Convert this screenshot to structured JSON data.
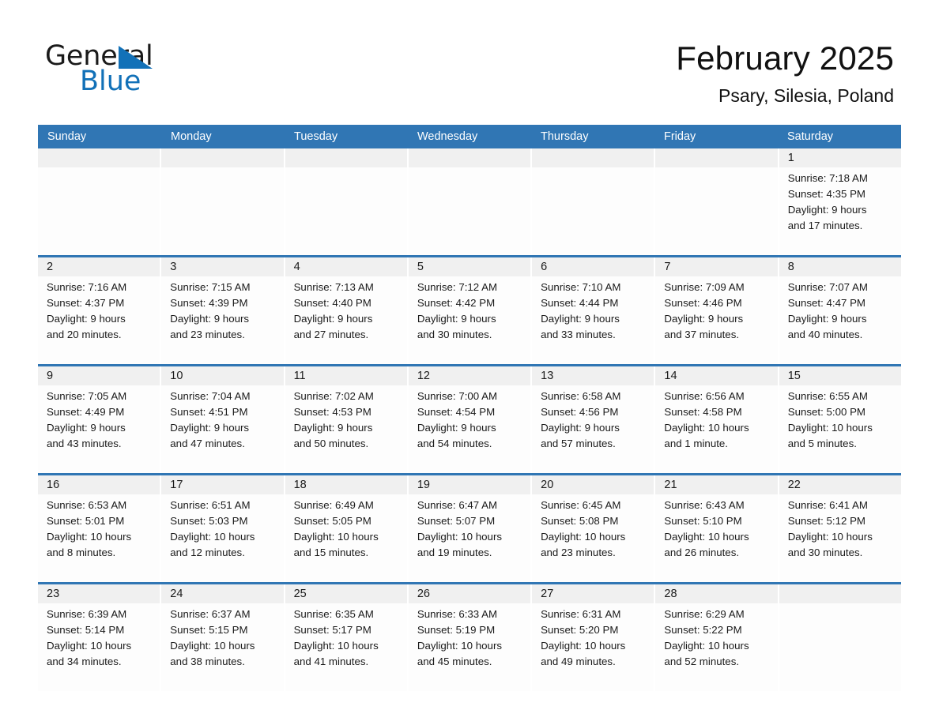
{
  "brand": {
    "name_part1": "General",
    "name_part2": "Blue",
    "triangle_color": "#1271b8"
  },
  "header": {
    "title": "February 2025",
    "subtitle": "Psary, Silesia, Poland"
  },
  "theme": {
    "header_blue": "#3076b4",
    "day_band_gray": "#f0f0f0",
    "text_color": "#1a1a1a"
  },
  "weekdays": [
    "Sunday",
    "Monday",
    "Tuesday",
    "Wednesday",
    "Thursday",
    "Friday",
    "Saturday"
  ],
  "weeks": [
    [
      {
        "num": "",
        "lines": []
      },
      {
        "num": "",
        "lines": []
      },
      {
        "num": "",
        "lines": []
      },
      {
        "num": "",
        "lines": []
      },
      {
        "num": "",
        "lines": []
      },
      {
        "num": "",
        "lines": []
      },
      {
        "num": "1",
        "lines": [
          "Sunrise: 7:18 AM",
          "Sunset: 4:35 PM",
          "Daylight: 9 hours",
          "and 17 minutes."
        ]
      }
    ],
    [
      {
        "num": "2",
        "lines": [
          "Sunrise: 7:16 AM",
          "Sunset: 4:37 PM",
          "Daylight: 9 hours",
          "and 20 minutes."
        ]
      },
      {
        "num": "3",
        "lines": [
          "Sunrise: 7:15 AM",
          "Sunset: 4:39 PM",
          "Daylight: 9 hours",
          "and 23 minutes."
        ]
      },
      {
        "num": "4",
        "lines": [
          "Sunrise: 7:13 AM",
          "Sunset: 4:40 PM",
          "Daylight: 9 hours",
          "and 27 minutes."
        ]
      },
      {
        "num": "5",
        "lines": [
          "Sunrise: 7:12 AM",
          "Sunset: 4:42 PM",
          "Daylight: 9 hours",
          "and 30 minutes."
        ]
      },
      {
        "num": "6",
        "lines": [
          "Sunrise: 7:10 AM",
          "Sunset: 4:44 PM",
          "Daylight: 9 hours",
          "and 33 minutes."
        ]
      },
      {
        "num": "7",
        "lines": [
          "Sunrise: 7:09 AM",
          "Sunset: 4:46 PM",
          "Daylight: 9 hours",
          "and 37 minutes."
        ]
      },
      {
        "num": "8",
        "lines": [
          "Sunrise: 7:07 AM",
          "Sunset: 4:47 PM",
          "Daylight: 9 hours",
          "and 40 minutes."
        ]
      }
    ],
    [
      {
        "num": "9",
        "lines": [
          "Sunrise: 7:05 AM",
          "Sunset: 4:49 PM",
          "Daylight: 9 hours",
          "and 43 minutes."
        ]
      },
      {
        "num": "10",
        "lines": [
          "Sunrise: 7:04 AM",
          "Sunset: 4:51 PM",
          "Daylight: 9 hours",
          "and 47 minutes."
        ]
      },
      {
        "num": "11",
        "lines": [
          "Sunrise: 7:02 AM",
          "Sunset: 4:53 PM",
          "Daylight: 9 hours",
          "and 50 minutes."
        ]
      },
      {
        "num": "12",
        "lines": [
          "Sunrise: 7:00 AM",
          "Sunset: 4:54 PM",
          "Daylight: 9 hours",
          "and 54 minutes."
        ]
      },
      {
        "num": "13",
        "lines": [
          "Sunrise: 6:58 AM",
          "Sunset: 4:56 PM",
          "Daylight: 9 hours",
          "and 57 minutes."
        ]
      },
      {
        "num": "14",
        "lines": [
          "Sunrise: 6:56 AM",
          "Sunset: 4:58 PM",
          "Daylight: 10 hours",
          "and 1 minute."
        ]
      },
      {
        "num": "15",
        "lines": [
          "Sunrise: 6:55 AM",
          "Sunset: 5:00 PM",
          "Daylight: 10 hours",
          "and 5 minutes."
        ]
      }
    ],
    [
      {
        "num": "16",
        "lines": [
          "Sunrise: 6:53 AM",
          "Sunset: 5:01 PM",
          "Daylight: 10 hours",
          "and 8 minutes."
        ]
      },
      {
        "num": "17",
        "lines": [
          "Sunrise: 6:51 AM",
          "Sunset: 5:03 PM",
          "Daylight: 10 hours",
          "and 12 minutes."
        ]
      },
      {
        "num": "18",
        "lines": [
          "Sunrise: 6:49 AM",
          "Sunset: 5:05 PM",
          "Daylight: 10 hours",
          "and 15 minutes."
        ]
      },
      {
        "num": "19",
        "lines": [
          "Sunrise: 6:47 AM",
          "Sunset: 5:07 PM",
          "Daylight: 10 hours",
          "and 19 minutes."
        ]
      },
      {
        "num": "20",
        "lines": [
          "Sunrise: 6:45 AM",
          "Sunset: 5:08 PM",
          "Daylight: 10 hours",
          "and 23 minutes."
        ]
      },
      {
        "num": "21",
        "lines": [
          "Sunrise: 6:43 AM",
          "Sunset: 5:10 PM",
          "Daylight: 10 hours",
          "and 26 minutes."
        ]
      },
      {
        "num": "22",
        "lines": [
          "Sunrise: 6:41 AM",
          "Sunset: 5:12 PM",
          "Daylight: 10 hours",
          "and 30 minutes."
        ]
      }
    ],
    [
      {
        "num": "23",
        "lines": [
          "Sunrise: 6:39 AM",
          "Sunset: 5:14 PM",
          "Daylight: 10 hours",
          "and 34 minutes."
        ]
      },
      {
        "num": "24",
        "lines": [
          "Sunrise: 6:37 AM",
          "Sunset: 5:15 PM",
          "Daylight: 10 hours",
          "and 38 minutes."
        ]
      },
      {
        "num": "25",
        "lines": [
          "Sunrise: 6:35 AM",
          "Sunset: 5:17 PM",
          "Daylight: 10 hours",
          "and 41 minutes."
        ]
      },
      {
        "num": "26",
        "lines": [
          "Sunrise: 6:33 AM",
          "Sunset: 5:19 PM",
          "Daylight: 10 hours",
          "and 45 minutes."
        ]
      },
      {
        "num": "27",
        "lines": [
          "Sunrise: 6:31 AM",
          "Sunset: 5:20 PM",
          "Daylight: 10 hours",
          "and 49 minutes."
        ]
      },
      {
        "num": "28",
        "lines": [
          "Sunrise: 6:29 AM",
          "Sunset: 5:22 PM",
          "Daylight: 10 hours",
          "and 52 minutes."
        ]
      },
      {
        "num": "",
        "lines": []
      }
    ]
  ]
}
